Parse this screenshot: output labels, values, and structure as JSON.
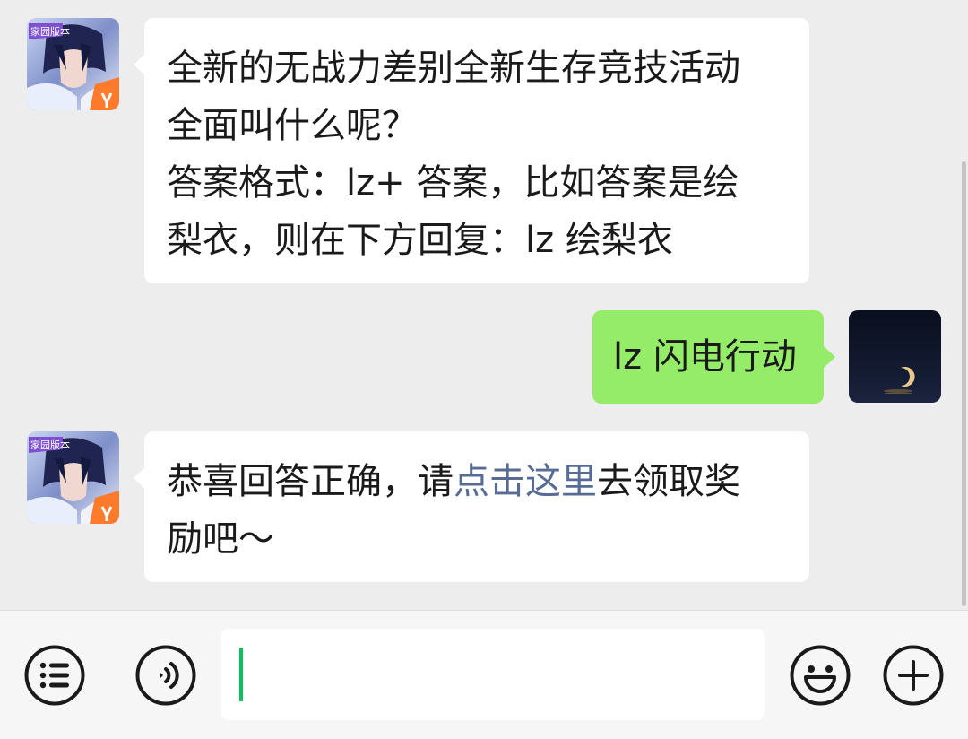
{
  "messages": [
    {
      "sender": "game-account",
      "badge": "家园版本",
      "lines": [
        "全新的无战力差别全新生存竞技活动",
        "全面叫什么呢？",
        "答案格式：lz+ 答案，比如答案是绘",
        "梨衣，则在下方回复：lz 绘梨衣"
      ]
    },
    {
      "sender": "self",
      "text": "lz 闪电行动"
    },
    {
      "sender": "game-account",
      "badge": "家园版本",
      "line1_before": "恭喜回答正确，请",
      "line1_link": "点击这里",
      "line1_after": "去领取奖",
      "line2": "励吧～"
    }
  ],
  "input": {
    "value": ""
  },
  "icons": {
    "left1": "menu-list-icon",
    "left2": "voice-icon",
    "right1": "emoji-icon",
    "right2": "plus-icon"
  },
  "colors": {
    "background": "#ededed",
    "incoming_bubble": "#ffffff",
    "outgoing_bubble": "#95ec69",
    "link": "#576b95",
    "caret": "#07c160"
  }
}
